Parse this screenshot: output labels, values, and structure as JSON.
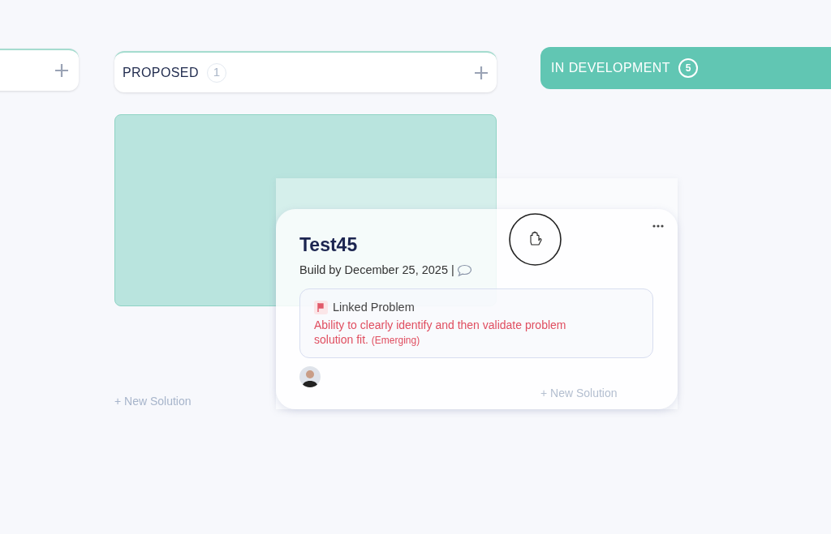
{
  "columns": [
    {
      "kind": "partial"
    },
    {
      "kind": "normal",
      "title": "PROPOSED",
      "count": "1",
      "drop_placeholder": true,
      "new_label": "+ New Solution"
    },
    {
      "kind": "active",
      "title": "IN DEVELOPMENT",
      "count": "5",
      "new_label": "+ New Solution"
    }
  ],
  "dragged_card": {
    "title": "Test45",
    "due": "Build by December 25, 2025 |",
    "linked_label": "Linked Problem",
    "linked_text": "Ability to clearly identify and then validate problem solution fit.",
    "linked_status": "(Emerging)"
  }
}
